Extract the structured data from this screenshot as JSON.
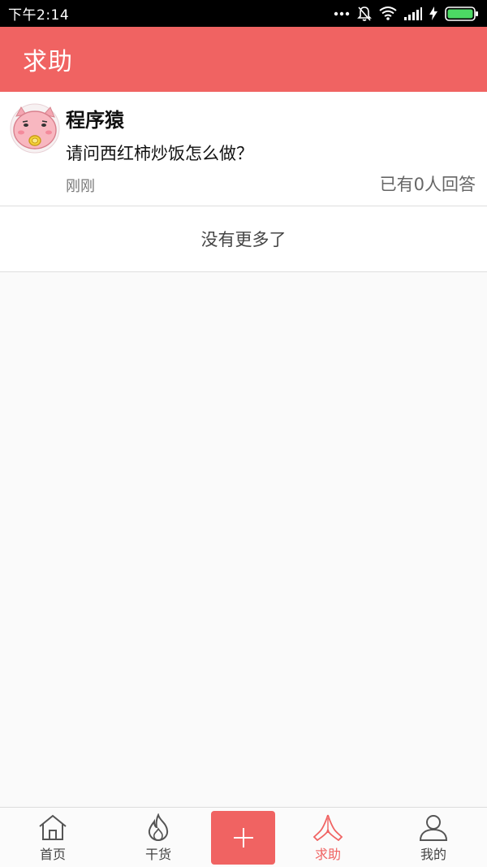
{
  "status_bar": {
    "time": "下午2:14",
    "icons": [
      "more-dots-icon",
      "mute-bell-icon",
      "wifi-icon",
      "signal-icon",
      "charging-icon",
      "battery-icon"
    ]
  },
  "header": {
    "title": "求助"
  },
  "posts": [
    {
      "author": "程序猿",
      "avatar_icon": "pig-avatar-icon",
      "question": "请问西红柿炒饭怎么做？",
      "time": "刚刚",
      "answers": "已有0人回答"
    }
  ],
  "list_footer": {
    "no_more": "没有更多了"
  },
  "bottom_nav": {
    "items": [
      {
        "label": "首页",
        "icon": "home-icon"
      },
      {
        "label": "干货",
        "icon": "flame-icon"
      },
      {
        "label": "",
        "icon": "plus-icon"
      },
      {
        "label": "求助",
        "icon": "praying-hands-icon",
        "active": true
      },
      {
        "label": "我的",
        "icon": "user-icon"
      }
    ]
  },
  "colors": {
    "accent": "#f06362",
    "status_bar": "#000000",
    "background": "#fafafa"
  }
}
